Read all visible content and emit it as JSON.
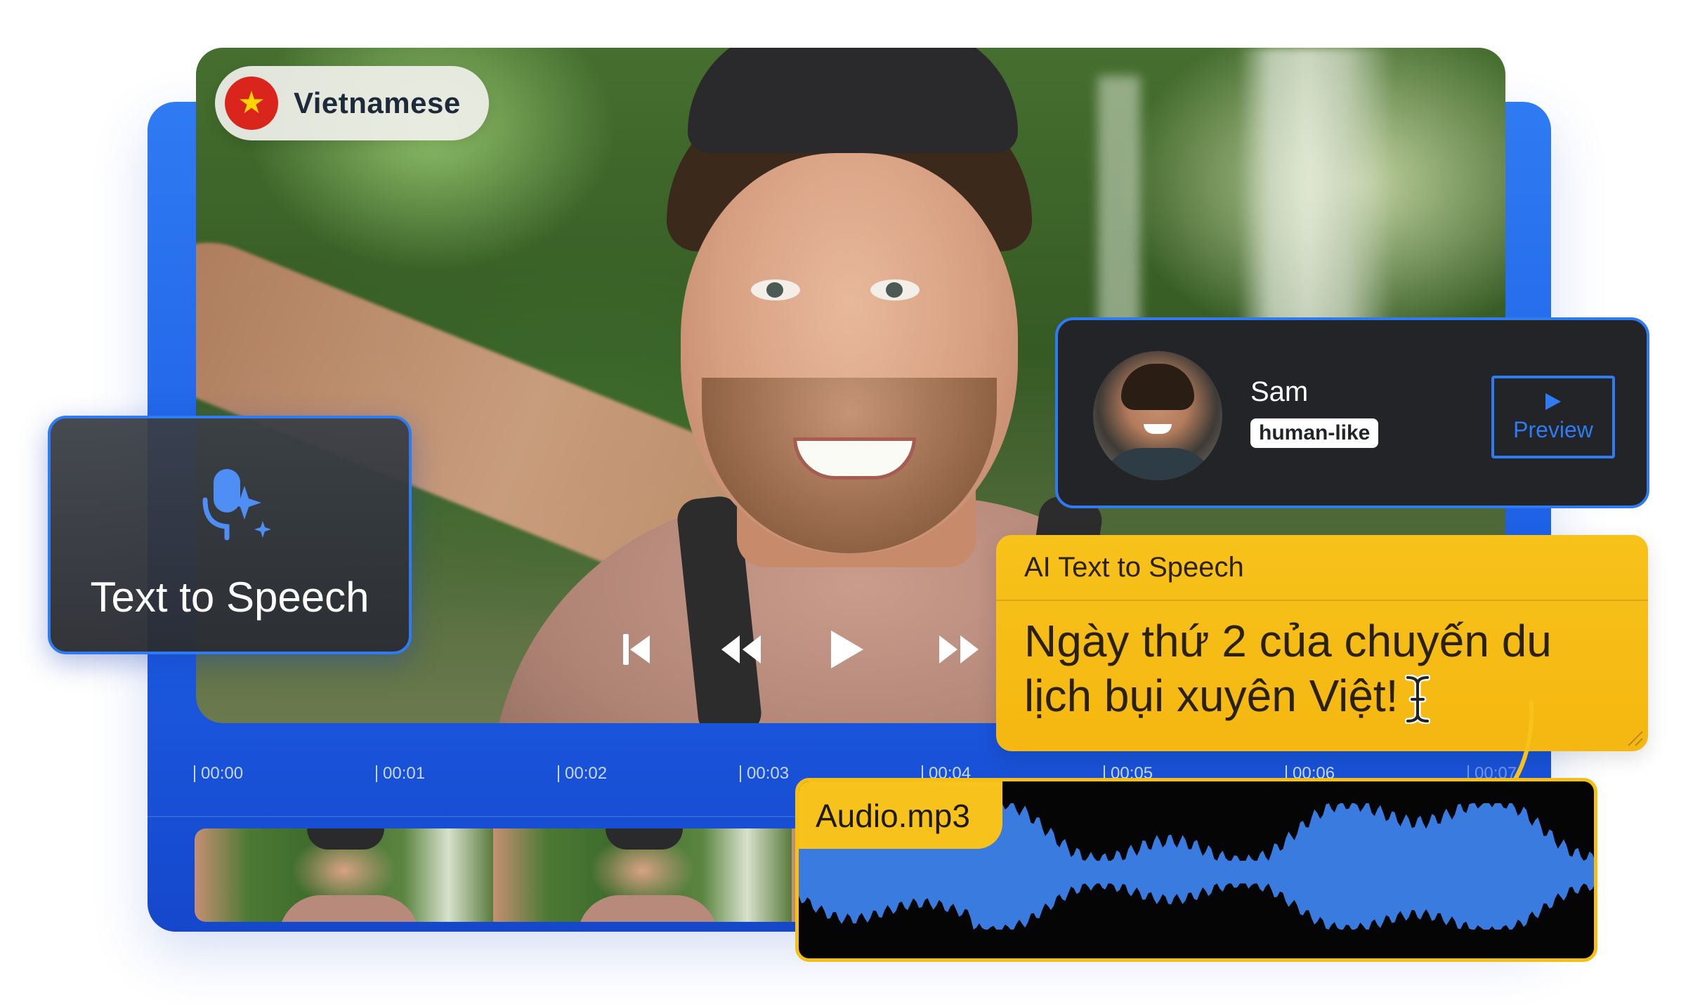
{
  "language_pill": {
    "label": "Vietnamese",
    "flag": "star-flag-icon",
    "flag_color": "#da251d"
  },
  "tts_card": {
    "label": "Text to Speech",
    "icon": "mic-sparkle-icon"
  },
  "voice_card": {
    "name": "Sam",
    "tag": "human-like",
    "preview_label": "Preview"
  },
  "ai_card": {
    "title": "AI Text to Speech",
    "text": "Ngày thứ 2 của chuyến du lịch bụi xuyên Việt!"
  },
  "audio": {
    "label": "Audio.mp3"
  },
  "timeline": {
    "ticks": [
      "00:00",
      "00:01",
      "00:02",
      "00:03",
      "00:04",
      "00:05",
      "00:06",
      "00:07"
    ]
  },
  "colors": {
    "accent_blue": "#2f7bf2",
    "yellow": "#f7c21b",
    "dark_card": "#222428"
  }
}
